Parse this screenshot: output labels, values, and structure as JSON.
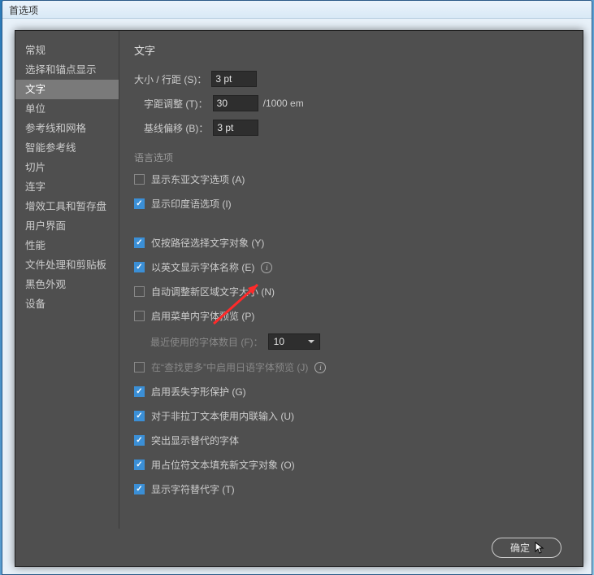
{
  "window_title": "首选项",
  "sidebar": {
    "items": [
      "常规",
      "选择和锚点显示",
      "文字",
      "单位",
      "参考线和网格",
      "智能参考线",
      "切片",
      "连字",
      "增效工具和暂存盘",
      "用户界面",
      "性能",
      "文件处理和剪贴板",
      "黑色外观",
      "设备"
    ],
    "selected_index": 2
  },
  "content": {
    "title": "文字",
    "size_label": "大小 / 行距 (S)：",
    "size_value": "3 pt",
    "kerning_label": "字距调整 (T)：",
    "kerning_value": "30",
    "kerning_unit": "/1000 em",
    "baseline_label": "基线偏移 (B)：",
    "baseline_value": "3 pt",
    "lang_title": "语言选项",
    "east_asian": "显示东亚文字选项 (A)",
    "indic": "显示印度语选项 (I)",
    "path_only": "仅按路径选择文字对象 (Y)",
    "english_names": "以英文显示字体名称 (E)",
    "auto_size": "自动调整新区域文字大小 (N)",
    "menu_preview": "启用菜单内字体预览 (P)",
    "recent_label": "最近使用的字体数目 (F)：",
    "recent_value": "10",
    "jp_preview": "在“查找更多”中启用日语字体预览 (J)",
    "missing_glyph": "启用丢失字形保护 (G)",
    "inline_input": "对于非拉丁文本使用内联输入 (U)",
    "highlight_alt": "突出显示替代的字体",
    "placeholder_fill": "用占位符文本填充新文字对象 (O)",
    "show_alt": "显示字符替代字 (T)"
  },
  "buttons": {
    "ok": "确定"
  }
}
